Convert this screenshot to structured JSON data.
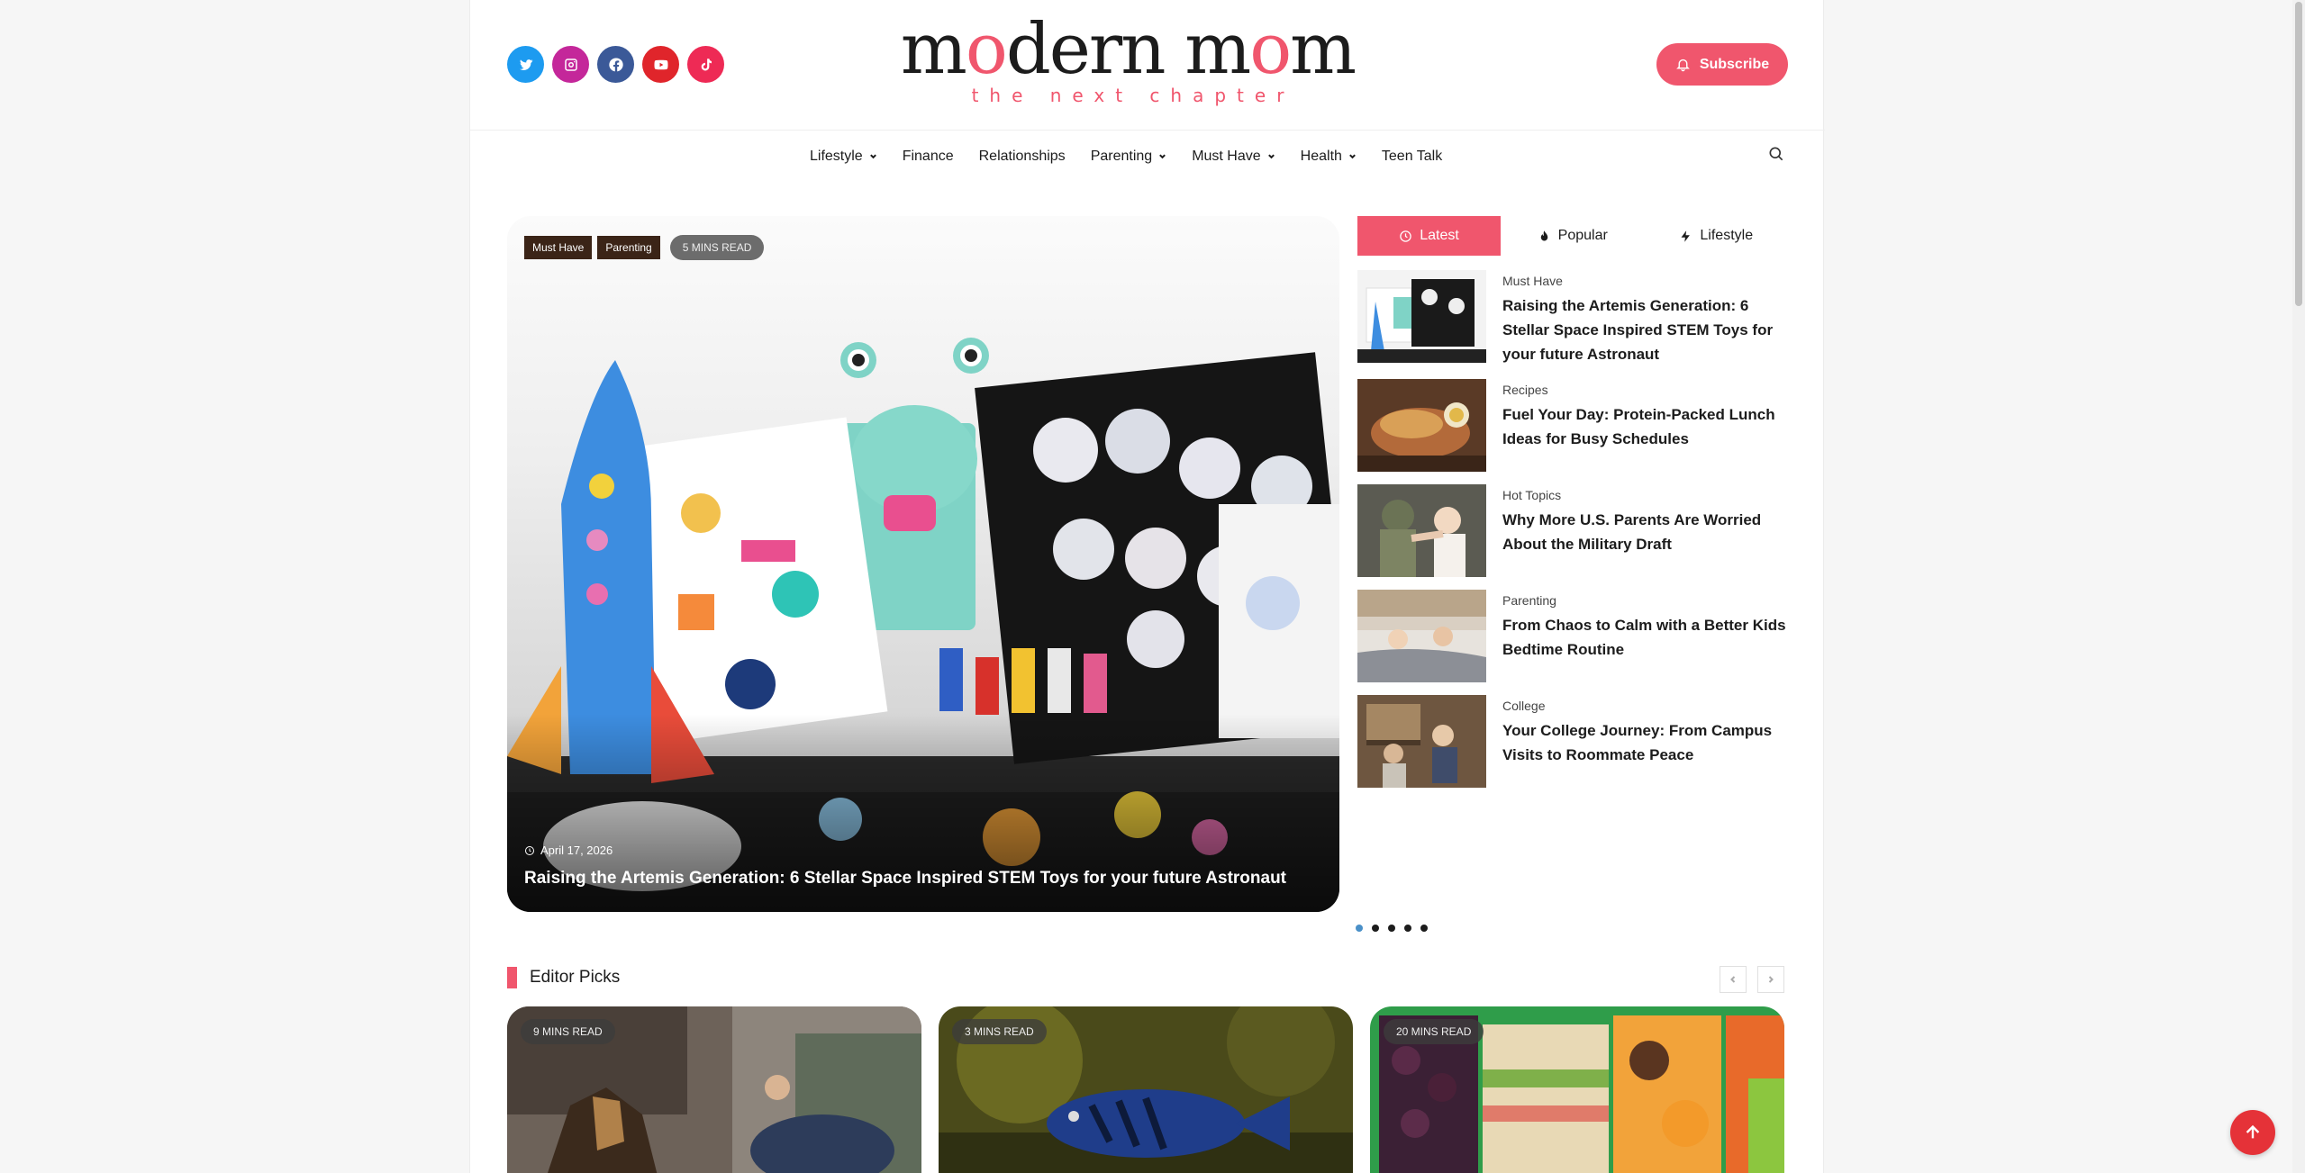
{
  "brand": {
    "logo_pre": "m",
    "logo_o1": "o",
    "logo_mid": "dern m",
    "logo_o2": "o",
    "logo_post": "m",
    "tagline": "the next chapter",
    "accent": "#f0566d"
  },
  "social": [
    {
      "name": "twitter-icon",
      "color": "#1d9bf0"
    },
    {
      "name": "instagram-icon",
      "color": "#c4279a"
    },
    {
      "name": "facebook-icon",
      "color": "#3b5998"
    },
    {
      "name": "youtube-icon",
      "color": "#e0252b"
    },
    {
      "name": "tiktok-icon",
      "color": "#ee2a55"
    }
  ],
  "header": {
    "subscribe_label": "Subscribe"
  },
  "nav": {
    "items": [
      {
        "label": "Lifestyle",
        "dropdown": true
      },
      {
        "label": "Finance",
        "dropdown": false
      },
      {
        "label": "Relationships",
        "dropdown": false
      },
      {
        "label": "Parenting",
        "dropdown": true
      },
      {
        "label": "Must Have",
        "dropdown": true
      },
      {
        "label": "Health",
        "dropdown": true
      },
      {
        "label": "Teen Talk",
        "dropdown": false
      }
    ]
  },
  "hero": {
    "tags": [
      "Must Have",
      "Parenting"
    ],
    "read_time": "5 MINS READ",
    "date": "April 17, 2026",
    "title": "Raising the Artemis Generation: 6 Stellar Space Inspired STEM Toys for your future Astronaut",
    "slides": 5,
    "active_slide": 1
  },
  "tabs": {
    "items": [
      {
        "label": "Latest",
        "icon": "clock-icon",
        "active": true
      },
      {
        "label": "Popular",
        "icon": "flame-icon",
        "active": false
      },
      {
        "label": "Lifestyle",
        "icon": "bolt-icon",
        "active": false
      }
    ],
    "posts": [
      {
        "category": "Must Have",
        "title": "Raising the Artemis Generation: 6 Stellar Space Inspired STEM Toys for your future Astronaut"
      },
      {
        "category": "Recipes",
        "title": "Fuel Your Day: Protein-Packed Lunch Ideas for Busy Schedules"
      },
      {
        "category": "Hot Topics",
        "title": "Why More U.S. Parents Are Worried About the Military Draft"
      },
      {
        "category": "Parenting",
        "title": "From Chaos to Calm with a Better Kids Bedtime Routine"
      },
      {
        "category": "College",
        "title": "Your College Journey: From Campus Visits to Roommate Peace"
      }
    ]
  },
  "picks": {
    "title": "Editor Picks",
    "cards": [
      {
        "read_time": "9 MINS READ"
      },
      {
        "read_time": "3 MINS READ"
      },
      {
        "read_time": "20 MINS READ"
      }
    ]
  }
}
